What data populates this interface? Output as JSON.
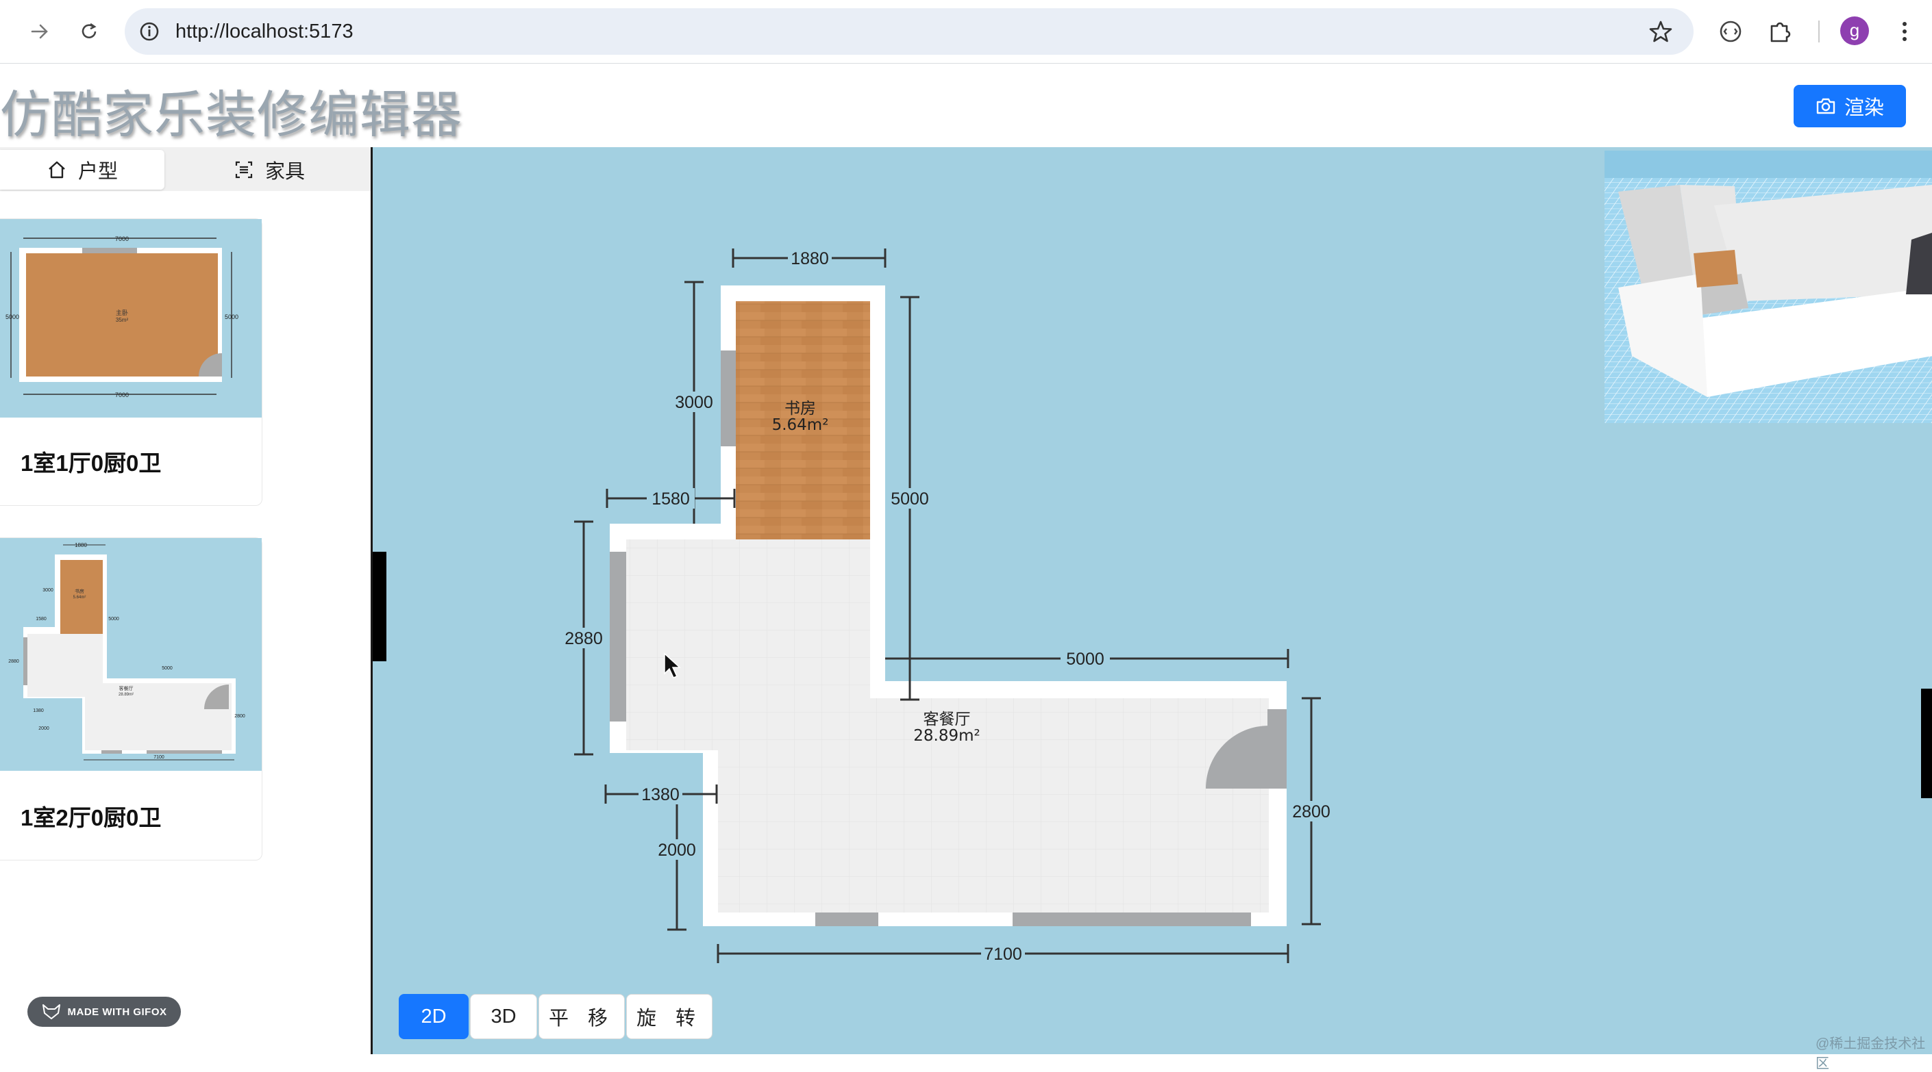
{
  "browser": {
    "url": "http://localhost:5173",
    "profile_initial": "g",
    "icons": [
      "forward-arrow-icon",
      "reload-icon",
      "site-info-icon",
      "bookmark-star-icon",
      "extension-icon",
      "puzzle-extension-icon",
      "kebab-menu-icon"
    ]
  },
  "header": {
    "title": "仿酷家乐装修编辑器",
    "render_label": "渲染"
  },
  "sidebar": {
    "tabs": [
      {
        "label": "户型",
        "icon": "home-icon"
      },
      {
        "label": "家具",
        "icon": "scan-icon"
      }
    ],
    "cards": [
      {
        "label": "1室1厅0厨0卫",
        "thumb": {
          "top": "7000",
          "bottom": "7000",
          "left": "5000",
          "right": "5000",
          "room": "主卧",
          "area": "35m²"
        }
      },
      {
        "label": "1室2厅0厨0卫",
        "thumb": {
          "top": "1880",
          "bottom": "7100",
          "room1": "书房",
          "area1": "5.64m²",
          "room2": "客餐厅",
          "area2": "28.89m²",
          "d1": "3000",
          "d2": "5000",
          "d3": "1580",
          "d4": "2880",
          "d5": "5000",
          "d6": "1380",
          "d7": "2000",
          "d8": "2800"
        }
      }
    ],
    "gifox": "MADE WITH GIFOX"
  },
  "plan": {
    "rooms": [
      {
        "name": "书房",
        "area": "5.64m²"
      },
      {
        "name": "客餐厅",
        "area": "28.89m²"
      }
    ],
    "dimensions": {
      "study_width": "1880",
      "study_left": "3000",
      "study_right": "5000",
      "step_left": "1580",
      "west_wall": "2880",
      "east_top": "5000",
      "south_step": "1380",
      "south_left": "2000",
      "east_wall": "2800",
      "bottom": "7100"
    }
  },
  "modes": [
    "2D",
    "3D",
    "平 移",
    "旋 转"
  ],
  "active_mode": "2D",
  "watermark": "@稀土掘金技术社区",
  "colors": {
    "accent": "#1677ff",
    "canvas_bg": "#a3d0e1",
    "wood": "#c98a52"
  }
}
